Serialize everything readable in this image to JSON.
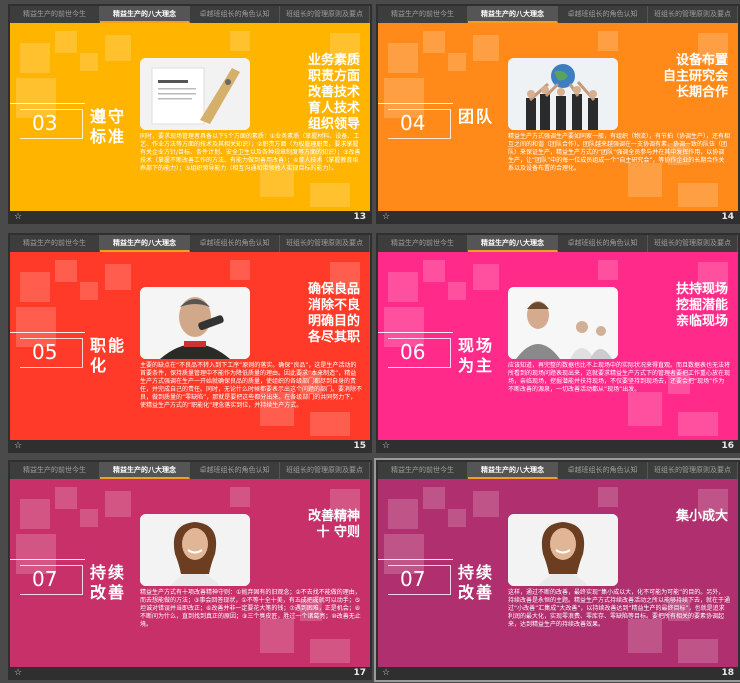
{
  "tabs": [
    "精益生产的前世今生",
    "精益生产的八大理念",
    "卓越班组长的角色认知",
    "班组长的管理原则及要点"
  ],
  "active_tab_index": 1,
  "slides": [
    {
      "page": "13",
      "number": "03",
      "title": "遵守标准",
      "headline": [
        "业务素质",
        "职责方面",
        "改善技术",
        "育人技术",
        "组织领导"
      ],
      "paragraph": "同时，要求现场管理者具备以下5个方面的素质：①业务素质（掌握材料、设备、工艺、作业方法等方面的技术及其相关知识）；②职责方面（为权管理职责，要求掌握有关企业方针/目标、条件计划、安全卫生以及各种规章制度等方面的知识）；③改善技术（掌握不断改善工作的方法、有能力做到善用改善）；④育人技术（掌握教育培养部下的能力）；⑤组织领导能力（相互沟通和带领他人实现目标的能力）。",
      "bg": "#ffb400",
      "photo": "notes-photo"
    },
    {
      "page": "14",
      "number": "04",
      "title": "团队",
      "headline": [
        "设备布置",
        "自主研究会",
        "长期合作"
      ],
      "paragraph": "精益生产方式强调生产要如同家一般，有组织（物流），有节拍（协调生产），还有相互之间的和谐（团队合作）。团队越来越强调在一支协调有素、协调一致的队伍（团队）来保证生产，精益生产方式的“团队”强调全员参与并在其中发挥作用，以协调生产，让“团队”中的每一位成员组成一个“自主研究会”，等协作企业的长期合作关系以及设备布置的合理化。",
      "bg": "#ff8a1a",
      "photo": "team-photo"
    },
    {
      "page": "15",
      "number": "05",
      "title": "职能化",
      "headline": [
        "确保良品",
        "消除不良",
        "明确目的",
        "各尽其职"
      ],
      "paragraph": "主要的缺点在“不良品不转入到下工序”原则的落实。确保“良品”，这是生产活动的首要条件，保持质量管理中不能作为降低质量的理由。因此要求“本来制造”，精益生产方式强调在生产一开始就确保良品的质量，使组织的各级部门都尽到自身的责任，并完成自己的责任。同时，无论什么时候都要表示出这个问题的部门。要消除不良，做到质量的“零缺陷”，那就是要把这些都分出来。在各级部门的共同努力下，使精益生产方式的“职能化”理念落实到位，并持续生产方式。",
      "bg": "#ff3a28",
      "photo": "man-phone-photo"
    },
    {
      "page": "16",
      "number": "06",
      "title": "现场为主",
      "headline": [
        "扶持现场",
        "挖掘潜能",
        "亲临现场"
      ],
      "paragraph": "应该知道，再完整的数据也比不上现场中的实际状况来得直观。而且数据表也无法将所看到的现场问题表现出来，这就要求精益生产方式下的管理者要把工作重心放在现场，亲临现场，挖掘潜能并扶持现场，不仅要坚持到现场去，还要会把“现场”作为不断改善的源泉，一切改善活动都从“现场”出发。",
      "bg": "#ff2a8a",
      "photo": "business-people-photo"
    },
    {
      "page": "17",
      "number": "07",
      "title": "持续改善",
      "headline": [
        "改善精神",
        "十 守则"
      ],
      "paragraph": "精益生产方式有十项改善精神守则：①抛弃固有的旧观念；②不去找不能做的理由，而去想能做的方法；③事会回答现状，①不等十全十美，有五成把握就可以动手；⑤坦诚对错误并当即改正；⑥改善并非一定要花大笔的钱；⑦遇到困难，正是机会；⑧不断问为什么，直到找到真正的原因；⑨三个臭皮匠，胜过一个诸葛亮；⑩改善无止境。",
      "bg": "#c8306a",
      "photo": "woman-photo"
    },
    {
      "page": "18",
      "number": "07",
      "title": "持续改善",
      "headline": [
        "集小成大"
      ],
      "paragraph": "这样，通过不断的改善，最终实现“集小成以大，化不可能为可能”的目的。另外，持续改善是永恒的主题。精益生产方式持续改善活动之所以能够持续下去，就在于通过“小改善”汇集成“大改善”，以持续改善达到“精益生产的最终目标”，也就是追求利润的最大化，实现零浪费、零库存、零缺陷等目标。要把所有相关的要素协调起来，达到精益生产的持续改善效果。",
      "bg": "#b02f6e",
      "photo": "woman-photo"
    }
  ],
  "icons": {
    "star": "slide-transition-star-icon"
  }
}
